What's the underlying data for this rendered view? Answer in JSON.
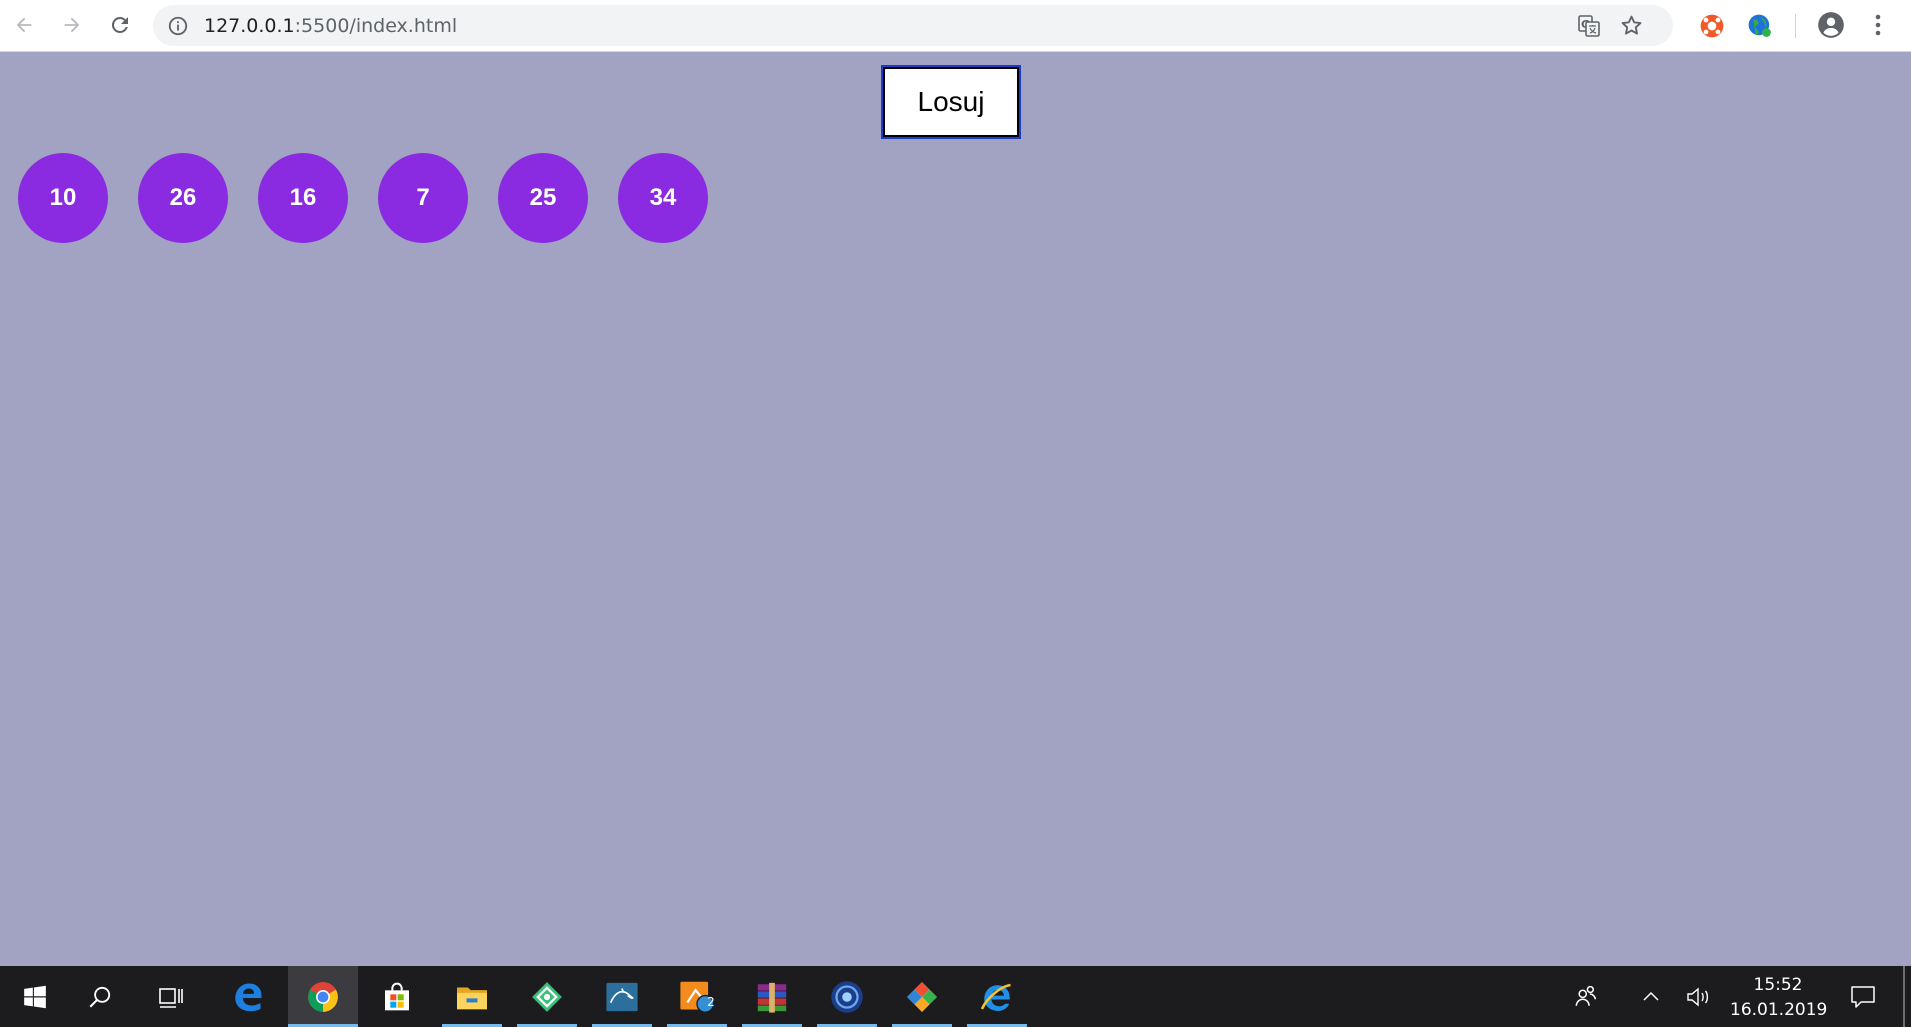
{
  "browser": {
    "url_host": "127.0.0.1",
    "url_path": ":5500/index.html",
    "icons": [
      "back-arrow-icon",
      "forward-arrow-icon",
      "reload-icon",
      "info-icon",
      "translate-icon",
      "star-icon",
      "extension-icon",
      "extension-globe-icon",
      "profile-icon",
      "more-menu-icon"
    ]
  },
  "page": {
    "background_color": "#a2a3c2",
    "draw_button_label": "Losuj",
    "ball_color": "#8a2be2",
    "balls": [
      "10",
      "26",
      "16",
      "7",
      "25",
      "34"
    ]
  },
  "taskbar": {
    "apps": [
      "start-icon",
      "search-icon",
      "task-view-icon",
      "edge-icon",
      "chrome-icon",
      "store-icon",
      "file-explorer-icon",
      "green-diamond-app-icon",
      "mysql-workbench-icon",
      "git-app-icon",
      "winrar-icon",
      "blue-circle-app-icon",
      "gitkraken-icon",
      "internet-explorer-icon"
    ],
    "git_badge": "2",
    "clock_time": "15:52",
    "clock_date": "16.01.2019"
  }
}
